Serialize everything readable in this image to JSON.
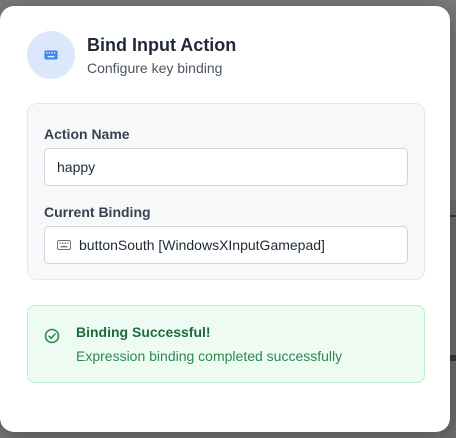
{
  "dialog": {
    "title": "Bind Input Action",
    "subtitle": "Configure key binding",
    "icon": "keyboard-icon"
  },
  "form": {
    "action_name_label": "Action Name",
    "action_name_value": "happy",
    "current_binding_label": "Current Binding",
    "current_binding_value": "buttonSouth [WindowsXInputGamepad]",
    "binding_icon": "keyboard-icon"
  },
  "status": {
    "title": "Binding Successful!",
    "message": "Expression binding completed successfully",
    "icon": "check-circle-icon",
    "color": "#2b8a4f"
  },
  "colors": {
    "accent": "#3b82f6",
    "success_bg": "#eefbf3"
  }
}
